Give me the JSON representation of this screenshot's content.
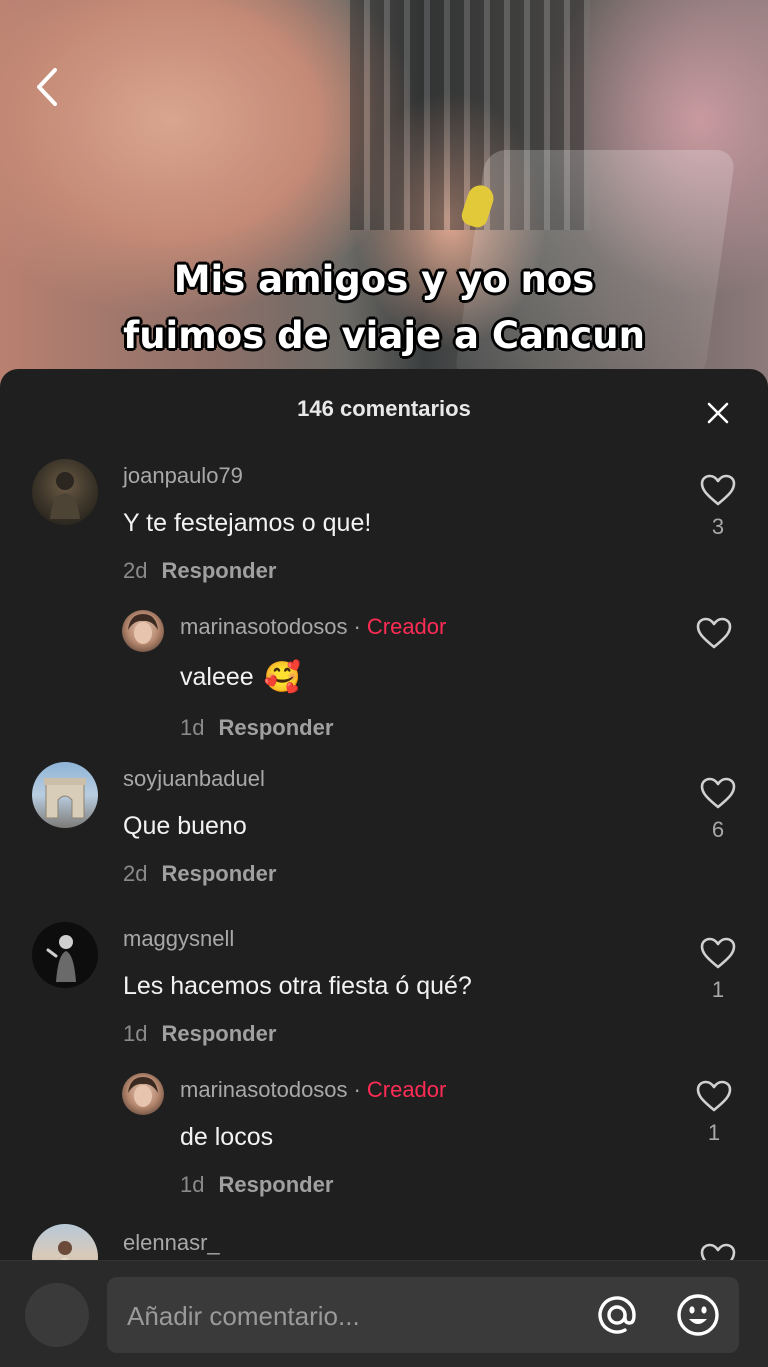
{
  "video": {
    "caption_line1": "Mis amigos y yo nos",
    "caption_line2": "fuimos de viaje a Cancun"
  },
  "header": {
    "comment_count": "146 comentarios"
  },
  "icons": {
    "back": "chevron-left-icon",
    "close": "close-icon",
    "like": "heart-outline-icon",
    "mention": "at-icon",
    "emoji": "smiley-icon"
  },
  "comments": [
    {
      "username": "joanpaulo79",
      "text": "Y te festejamos o que!",
      "age": "2d",
      "reply": "Responder",
      "likes": "3",
      "replies": [
        {
          "username": "marinasotodosos",
          "badge": "Creador",
          "text": "valeee",
          "emoji": "🥰",
          "age": "1d",
          "reply": "Responder",
          "likes": ""
        }
      ]
    },
    {
      "username": "soyjuanbaduel",
      "text": "Que bueno",
      "age": "2d",
      "reply": "Responder",
      "likes": "6",
      "replies": []
    },
    {
      "username": "maggysnell",
      "text": "Les hacemos otra fiesta ó qué?",
      "age": "1d",
      "reply": "Responder",
      "likes": "1",
      "replies": [
        {
          "username": "marinasotodosos",
          "badge": "Creador",
          "text": "de locos",
          "age": "1d",
          "reply": "Responder",
          "likes": "1"
        }
      ]
    },
    {
      "username": "elennasr_",
      "text": "",
      "age": "",
      "reply": "",
      "likes": "",
      "replies": []
    }
  ],
  "separator": "·",
  "input": {
    "placeholder": "Añadir comentario..."
  },
  "colors": {
    "sheet_bg": "#1f1f1f",
    "creator_badge": "#fe2c55",
    "muted_text": "#a8a8a8"
  }
}
